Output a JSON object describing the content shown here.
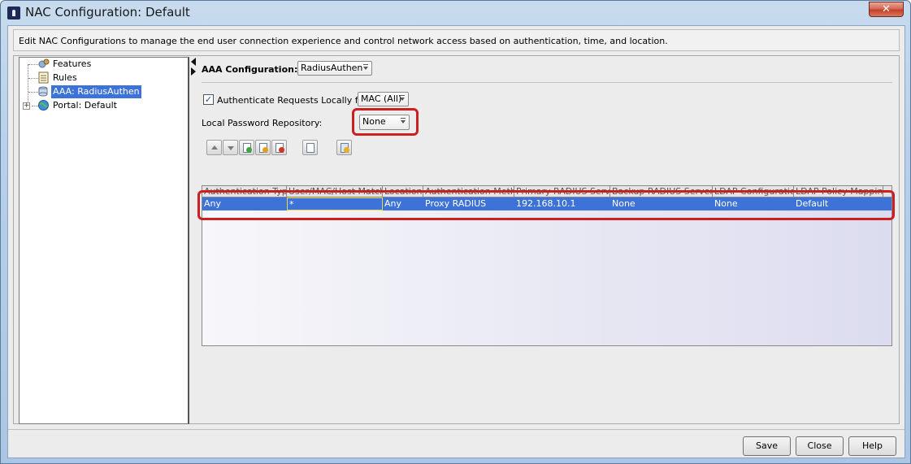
{
  "window": {
    "title": "NAC Configuration: Default",
    "close_glyph": "✕"
  },
  "description": "Edit NAC Configurations to manage the end user connection experience and control network access based on authentication, time, and location.",
  "tree": {
    "items": [
      {
        "label": "Features",
        "icon": "features-icon"
      },
      {
        "label": "Rules",
        "icon": "rules-icon"
      },
      {
        "label": "AAA: RadiusAuthen",
        "icon": "aaa-icon",
        "selected": true
      },
      {
        "label": "Portal: Default",
        "icon": "portal-globe-icon",
        "expander": "+"
      }
    ]
  },
  "aaa": {
    "label": "AAA Configuration:",
    "value": "RadiusAuthen"
  },
  "auth_local": {
    "checked": true,
    "check_glyph": "✓",
    "label": "Authenticate Requests Locally for",
    "value": "MAC (All)"
  },
  "password_repo": {
    "label": "Local Password Repository:",
    "value": "None"
  },
  "table": {
    "columns": [
      "Authentication Type",
      "User/MAC/Host Match",
      "Location",
      "Authentication Method",
      "Primary RADIUS Server",
      "Backup RADIUS Server",
      "LDAP Configuration",
      "LDAP Policy Mapping"
    ],
    "rows": [
      [
        "Any",
        "*",
        "Any",
        "Proxy RADIUS",
        "192.168.10.1",
        "None",
        "None",
        "Default"
      ]
    ]
  },
  "buttons": {
    "save": "Save",
    "close": "Close",
    "help": "Help"
  },
  "colors": {
    "selection": "#3d73d9",
    "highlight": "#cc1f1f"
  }
}
